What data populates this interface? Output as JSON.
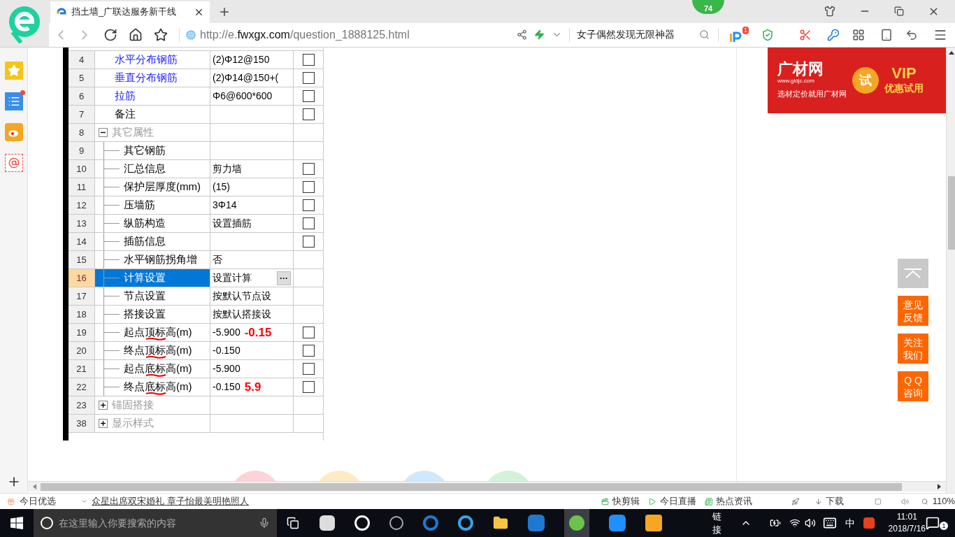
{
  "browser": {
    "tab_title": "挡土墙_广联达服务新干线",
    "score_badge": "74",
    "url": {
      "prefix": "http://e.",
      "domain": "fwxgx.com",
      "path": "/question_1888125.html"
    },
    "search": {
      "value": "女子偶然发现无限神器"
    },
    "notification_badge": "1"
  },
  "property_table": {
    "rows": [
      {
        "num": "4",
        "label": "水平分布钢筋",
        "kind": "public",
        "value": "(2)Φ12@150",
        "checked": false,
        "selected": false
      },
      {
        "num": "5",
        "label": "垂直分布钢筋",
        "kind": "public",
        "value": "(2)Φ14@150+(",
        "checked": false,
        "selected": false
      },
      {
        "num": "6",
        "label": "拉筋",
        "kind": "public",
        "value": "Φ6@600*600",
        "checked": false,
        "selected": false
      },
      {
        "num": "7",
        "label": "备注",
        "kind": "private",
        "checked": false,
        "selected": false
      },
      {
        "num": "8",
        "label": "其它属性",
        "kind": "group",
        "expanded": true,
        "selected": false,
        "children": [
          {
            "num": "9",
            "label": "其它钢筋",
            "kind": "private",
            "selected": false
          },
          {
            "num": "10",
            "label": "汇总信息",
            "kind": "private",
            "value": "剪力墙",
            "checked": false,
            "selected": false
          },
          {
            "num": "11",
            "label": "保护层厚度(mm)",
            "kind": "private",
            "value": "(15)",
            "checked": false,
            "selected": false
          },
          {
            "num": "12",
            "label": "压墙筋",
            "kind": "private",
            "value": "3Φ14",
            "checked": false,
            "selected": false
          },
          {
            "num": "13",
            "label": "纵筋构造",
            "kind": "private",
            "value": "设置插筋",
            "checked": false,
            "selected": false
          },
          {
            "num": "14",
            "label": "插筋信息",
            "kind": "private",
            "checked": false,
            "selected": false
          },
          {
            "num": "15",
            "label": "水平钢筋拐角增",
            "kind": "private",
            "value": "否",
            "selected": false
          },
          {
            "num": "16",
            "label": "计算设置",
            "kind": "private",
            "value": "设置计算",
            "more_button": "···",
            "selected": true
          },
          {
            "num": "17",
            "label": "节点设置",
            "kind": "private",
            "value": "按默认节点设",
            "selected": false
          },
          {
            "num": "18",
            "label": "搭接设置",
            "kind": "private",
            "value": "按默认搭接设",
            "selected": false
          },
          {
            "num": "19",
            "label": "起点顶标高(m)",
            "kind": "private",
            "value": "-5.900",
            "annotation": "-0.15",
            "underlined": true,
            "checked": false,
            "selected": false
          },
          {
            "num": "20",
            "label": "终点顶标高(m)",
            "kind": "private",
            "value": "-0.150",
            "underlined": true,
            "checked": false,
            "selected": false
          },
          {
            "num": "21",
            "label": "起点底标高(m)",
            "kind": "private",
            "value": "-5.900",
            "underlined": true,
            "checked": false,
            "selected": false
          },
          {
            "num": "22",
            "label": "终点底标高(m)",
            "kind": "private",
            "value": "-0.150",
            "annotation": "5.9",
            "underlined": true,
            "checked": false,
            "selected": false
          }
        ]
      },
      {
        "num": "23",
        "label": "锚固搭接",
        "kind": "group",
        "expanded": false,
        "selected": false
      },
      {
        "num": "38",
        "label": "显示样式",
        "kind": "group",
        "expanded": false,
        "selected": false
      }
    ]
  },
  "ad": {
    "brand": "广材网",
    "site": "www.gldjc.com",
    "slogan": "选材定价就用广材网",
    "try_badge": "试",
    "vip": "VIP",
    "offer": "优惠试用"
  },
  "float_buttons": [
    {
      "lines": [
        "意见",
        "反馈"
      ]
    },
    {
      "lines": [
        "关注",
        "我们"
      ]
    },
    {
      "lines": [
        "Q Q",
        "咨询"
      ]
    }
  ],
  "status_bar": {
    "left_label": "今日优选",
    "news": "众星出席双宋婚礼 章子怡最美明艳照人",
    "items": [
      "快剪辑",
      "今日直播",
      "热点资讯"
    ],
    "download": "下载",
    "zoom": "110%"
  },
  "taskbar": {
    "search_placeholder": "在这里输入你要搜索的内容",
    "links_label": "链接",
    "ime": "中",
    "time": "11:01",
    "date": "2018/7/16",
    "notifications": "1"
  }
}
